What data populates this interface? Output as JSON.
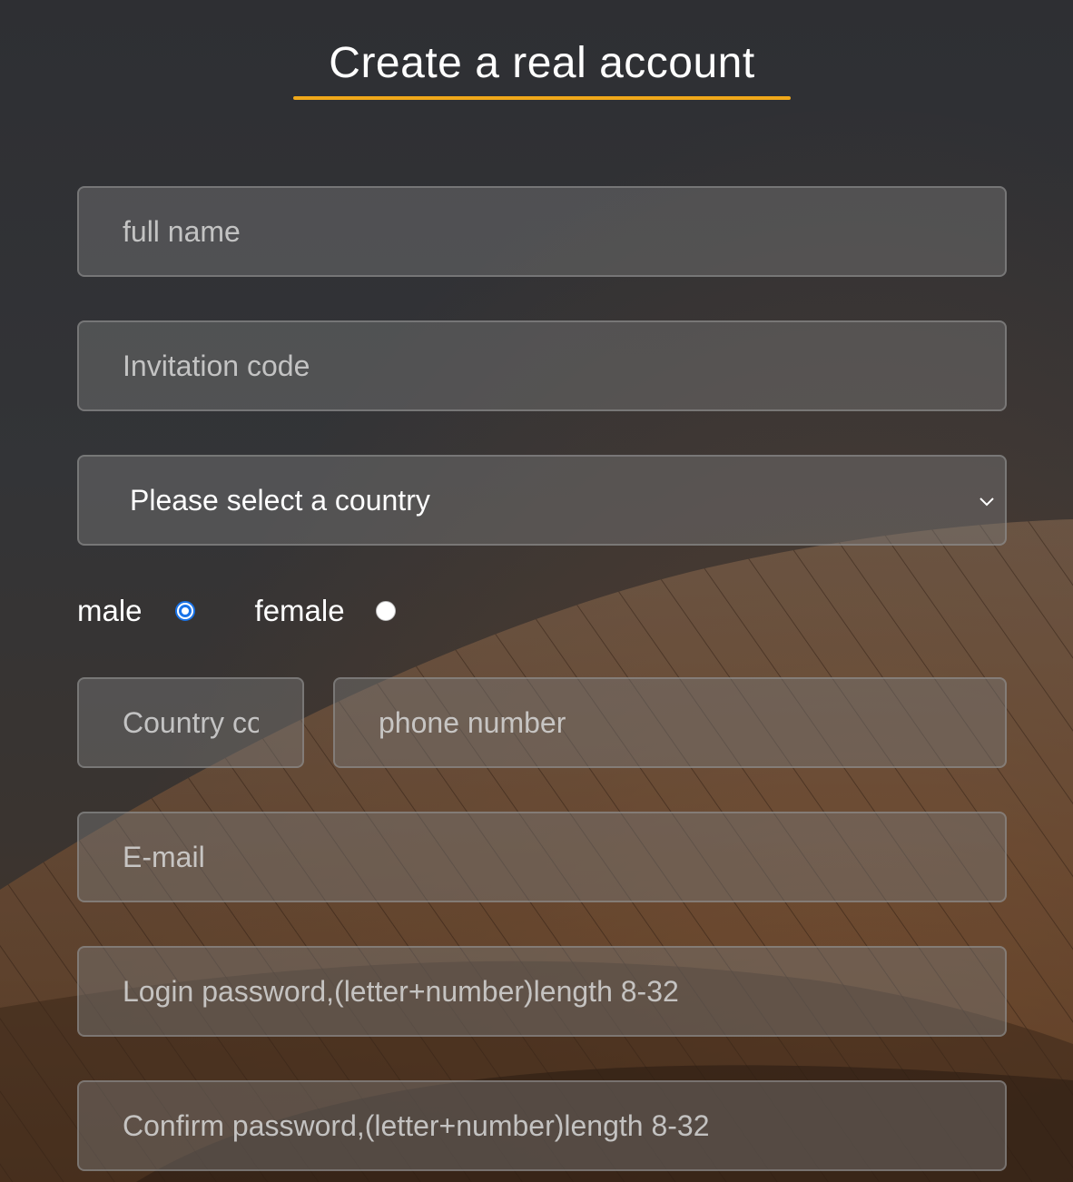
{
  "title": "Create a real account",
  "colors": {
    "accent_underline": "#f0a81a",
    "radio_selected": "#1a73e8"
  },
  "fields": {
    "full_name": {
      "placeholder": "full name",
      "value": ""
    },
    "invitation_code": {
      "placeholder": "Invitation code",
      "value": ""
    },
    "country_select": {
      "selected": "Please select a country",
      "icon": "chevron-down-icon"
    },
    "country_code": {
      "placeholder": "Country code",
      "value": ""
    },
    "phone_number": {
      "placeholder": "phone number",
      "value": ""
    },
    "email": {
      "placeholder": "E-mail",
      "value": ""
    },
    "login_password": {
      "placeholder": "Login password,(letter+number)length 8-32",
      "value": ""
    },
    "confirm_password": {
      "placeholder": "Confirm password,(letter+number)length 8-32",
      "value": ""
    }
  },
  "gender": {
    "options": [
      {
        "label": "male",
        "checked": true
      },
      {
        "label": "female",
        "checked": false
      }
    ]
  }
}
